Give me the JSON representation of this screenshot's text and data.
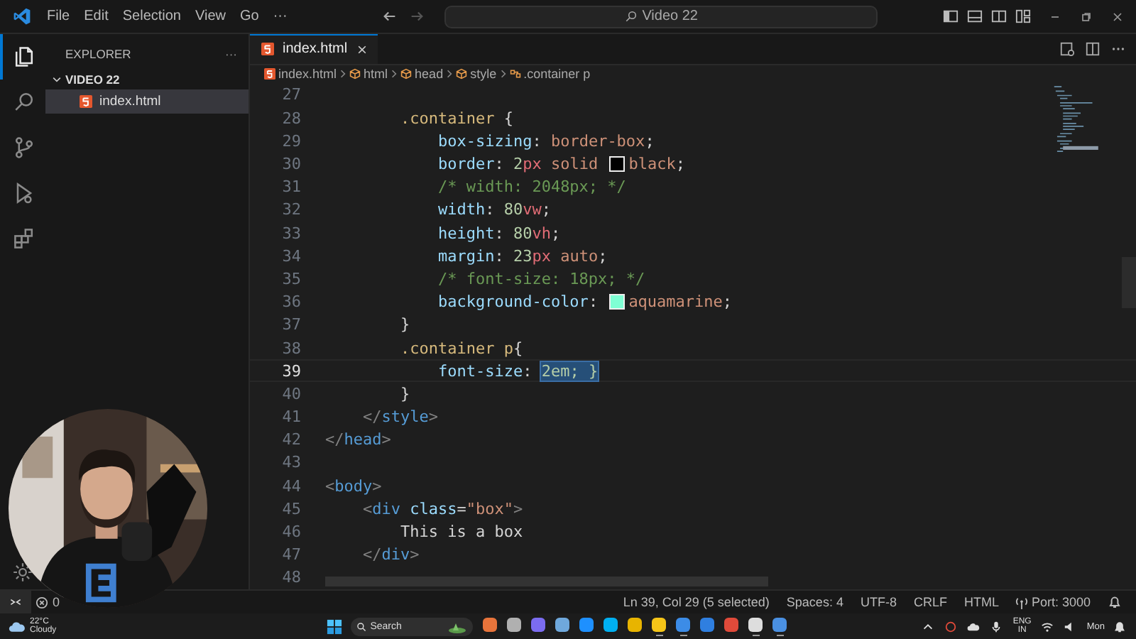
{
  "title_bar": {
    "menu": [
      "File",
      "Edit",
      "Selection",
      "View",
      "Go",
      "···"
    ],
    "command_center": "Video 22"
  },
  "activity_bar": [
    {
      "kind": "files",
      "selected": true
    },
    {
      "kind": "search",
      "selected": false
    },
    {
      "kind": "scm",
      "selected": false
    },
    {
      "kind": "debug",
      "selected": false
    },
    {
      "kind": "extensions",
      "selected": false
    }
  ],
  "explorer": {
    "title": "EXPLORER",
    "more": "···",
    "folder": {
      "name": "VIDEO 22",
      "expanded": true,
      "children": [
        {
          "name": "index.html",
          "selected": true
        }
      ]
    }
  },
  "tabs": [
    {
      "label": "index.html",
      "selected": true
    }
  ],
  "breadcrumbs": [
    {
      "label": "index.html",
      "kind": "file"
    },
    {
      "label": "html",
      "kind": "element"
    },
    {
      "label": "head",
      "kind": "element"
    },
    {
      "label": "style",
      "kind": "element"
    },
    {
      "label": ".container p",
      "kind": "rule"
    }
  ],
  "code": [
    {
      "number": "27",
      "current": false
    },
    {
      "number": "28",
      "current": false,
      "tokens": [
        {
          "kind": "selector",
          "text": "        .container "
        },
        {
          "kind": "punc",
          "text": "{"
        }
      ]
    },
    {
      "number": "29",
      "current": false,
      "tokens": [
        {
          "kind": "prop",
          "text": "            box-sizing"
        },
        {
          "kind": "punc",
          "text": ": "
        },
        {
          "kind": "val",
          "text": "border-box"
        },
        {
          "kind": "punc",
          "text": ";"
        }
      ]
    },
    {
      "number": "30",
      "current": false,
      "tokens": [
        {
          "kind": "prop",
          "text": "            border"
        },
        {
          "kind": "punc",
          "text": ": "
        },
        {
          "kind": "num",
          "text": "2"
        },
        {
          "kind": "unit",
          "text": "px"
        },
        {
          "kind": "val",
          "text": " solid "
        },
        {
          "kind": "swatch",
          "color": "#000000"
        },
        {
          "kind": "val",
          "text": "black"
        },
        {
          "kind": "punc",
          "text": ";"
        }
      ]
    },
    {
      "number": "31",
      "current": false,
      "tokens": [
        {
          "kind": "comment",
          "text": "            /* width: 2048px; */"
        }
      ]
    },
    {
      "number": "32",
      "current": false,
      "tokens": [
        {
          "kind": "prop",
          "text": "            width"
        },
        {
          "kind": "punc",
          "text": ": "
        },
        {
          "kind": "num",
          "text": "80"
        },
        {
          "kind": "unit",
          "text": "vw"
        },
        {
          "kind": "punc",
          "text": ";"
        }
      ]
    },
    {
      "number": "33",
      "current": false,
      "tokens": [
        {
          "kind": "prop",
          "text": "            height"
        },
        {
          "kind": "punc",
          "text": ": "
        },
        {
          "kind": "num",
          "text": "80"
        },
        {
          "kind": "unit",
          "text": "vh"
        },
        {
          "kind": "punc",
          "text": ";"
        }
      ]
    },
    {
      "number": "34",
      "current": false,
      "tokens": [
        {
          "kind": "prop",
          "text": "            margin"
        },
        {
          "kind": "punc",
          "text": ": "
        },
        {
          "kind": "num",
          "text": "23"
        },
        {
          "kind": "unit",
          "text": "px"
        },
        {
          "kind": "val",
          "text": " auto"
        },
        {
          "kind": "punc",
          "text": ";"
        }
      ]
    },
    {
      "number": "35",
      "current": false,
      "tokens": [
        {
          "kind": "comment",
          "text": "            /* font-size: 18px; */"
        }
      ]
    },
    {
      "number": "36",
      "current": false,
      "tokens": [
        {
          "kind": "prop",
          "text": "            background-color"
        },
        {
          "kind": "punc",
          "text": ": "
        },
        {
          "kind": "swatch",
          "color": "#7fffd4"
        },
        {
          "kind": "val",
          "text": "aquamarine"
        },
        {
          "kind": "punc",
          "text": ";"
        }
      ]
    },
    {
      "number": "37",
      "current": false,
      "tokens": [
        {
          "kind": "punc",
          "text": "        }"
        }
      ]
    },
    {
      "number": "38",
      "current": false,
      "tokens": [
        {
          "kind": "selector",
          "text": "        .container p"
        },
        {
          "kind": "punc",
          "text": "{"
        }
      ]
    },
    {
      "number": "39",
      "current": true,
      "tokens": [
        {
          "kind": "prop",
          "text": "            font-size"
        },
        {
          "kind": "punc",
          "text": ": "
        },
        {
          "kind": "selection",
          "text": "2em; }"
        }
      ]
    },
    {
      "number": "40",
      "current": false,
      "tokens": [
        {
          "kind": "punc",
          "text": "        }"
        }
      ]
    },
    {
      "number": "41",
      "current": false,
      "tokens": [
        {
          "kind": "bracket",
          "text": "    </"
        },
        {
          "kind": "tag",
          "text": "style"
        },
        {
          "kind": "bracket",
          "text": ">"
        }
      ]
    },
    {
      "number": "42",
      "current": false,
      "tokens": [
        {
          "kind": "bracket",
          "text": "</"
        },
        {
          "kind": "tag",
          "text": "head"
        },
        {
          "kind": "bracket",
          "text": ">"
        }
      ]
    },
    {
      "number": "43",
      "current": false
    },
    {
      "number": "44",
      "current": false,
      "tokens": [
        {
          "kind": "bracket",
          "text": "<"
        },
        {
          "kind": "tag",
          "text": "body"
        },
        {
          "kind": "bracket",
          "text": ">"
        }
      ]
    },
    {
      "number": "45",
      "current": false,
      "tokens": [
        {
          "kind": "bracket",
          "text": "    <"
        },
        {
          "kind": "tag",
          "text": "div "
        },
        {
          "kind": "prop",
          "text": "class"
        },
        {
          "kind": "punc",
          "text": "="
        },
        {
          "kind": "val",
          "text": "\"box\""
        },
        {
          "kind": "bracket",
          "text": ">"
        }
      ]
    },
    {
      "number": "46",
      "current": false,
      "tokens": [
        {
          "kind": "punc",
          "text": "        This is a box"
        }
      ]
    },
    {
      "number": "47",
      "current": false,
      "tokens": [
        {
          "kind": "bracket",
          "text": "    </"
        },
        {
          "kind": "tag",
          "text": "div"
        },
        {
          "kind": "bracket",
          "text": ">"
        }
      ]
    },
    {
      "number": "48",
      "current": false
    }
  ],
  "status_bar": {
    "errors": "0",
    "cursor": "Ln 39, Col 29 (5 selected)",
    "indent": "Spaces: 4",
    "encoding": "UTF-8",
    "eol": "CRLF",
    "language": "HTML",
    "port": "Port: 3000"
  },
  "taskbar": {
    "weather": {
      "temperature": "22°C",
      "condition": "Cloudy"
    },
    "search": {
      "placeholder": "Search"
    },
    "apps": [
      {
        "color": "#e8743b",
        "running": false
      },
      {
        "color": "#b0b0b0",
        "running": false
      },
      {
        "color": "#7b6cf0",
        "running": false
      },
      {
        "color": "#6fa8dc",
        "running": false
      },
      {
        "color": "#1e90ff",
        "running": false
      },
      {
        "color": "#00aff0",
        "running": false
      },
      {
        "color": "#e8b400",
        "running": false
      },
      {
        "color": "#f5c518",
        "running": true
      },
      {
        "color": "#3c8ce7",
        "running": true
      },
      {
        "color": "#2f7fe0",
        "running": false
      },
      {
        "color": "#e04a3a",
        "running": false
      },
      {
        "color": "#dddddd",
        "running": true
      },
      {
        "color": "#4a90e2",
        "running": true
      }
    ],
    "language": [
      "ENG",
      "IN"
    ],
    "day": "Mon"
  }
}
